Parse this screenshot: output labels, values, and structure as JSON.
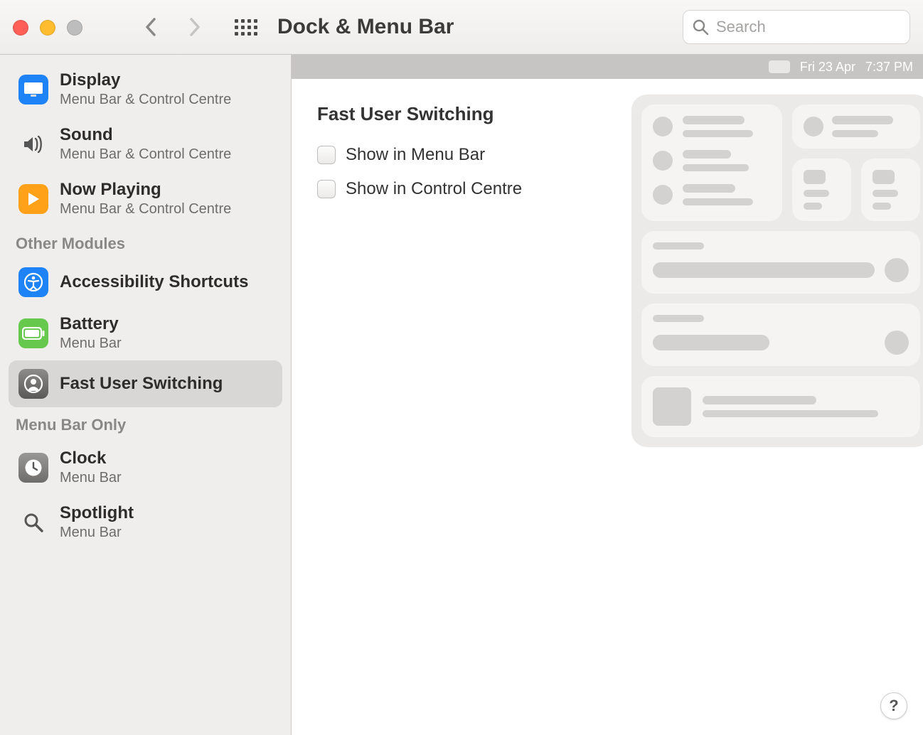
{
  "window": {
    "title": "Dock & Menu Bar",
    "search_placeholder": "Search"
  },
  "preview": {
    "date_text": "Fri 23 Apr",
    "time_text": "7:37 PM"
  },
  "pane": {
    "heading": "Fast User Switching",
    "options": [
      {
        "label": "Show in Menu Bar",
        "checked": false
      },
      {
        "label": "Show in Control Centre",
        "checked": false
      }
    ],
    "help_label": "?"
  },
  "sidebar": {
    "groups": [
      {
        "header": null,
        "items": [
          {
            "id": "display",
            "label": "Display",
            "sublabel": "Menu Bar & Control Centre",
            "icon": "display-icon",
            "selected": false
          },
          {
            "id": "sound",
            "label": "Sound",
            "sublabel": "Menu Bar & Control Centre",
            "icon": "sound-icon",
            "selected": false
          },
          {
            "id": "nowplay",
            "label": "Now Playing",
            "sublabel": "Menu Bar & Control Centre",
            "icon": "play-icon",
            "selected": false
          }
        ]
      },
      {
        "header": "Other Modules",
        "items": [
          {
            "id": "access",
            "label": "Accessibility Shortcuts",
            "sublabel": null,
            "icon": "accessibility-icon",
            "selected": false
          },
          {
            "id": "battery",
            "label": "Battery",
            "sublabel": "Menu Bar",
            "icon": "battery-icon",
            "selected": false
          },
          {
            "id": "fastuser",
            "label": "Fast User Switching",
            "sublabel": null,
            "icon": "user-icon",
            "selected": true
          }
        ]
      },
      {
        "header": "Menu Bar Only",
        "items": [
          {
            "id": "clock",
            "label": "Clock",
            "sublabel": "Menu Bar",
            "icon": "clock-icon",
            "selected": false
          },
          {
            "id": "spotlight",
            "label": "Spotlight",
            "sublabel": "Menu Bar",
            "icon": "spotlight-icon",
            "selected": false
          }
        ]
      }
    ]
  }
}
